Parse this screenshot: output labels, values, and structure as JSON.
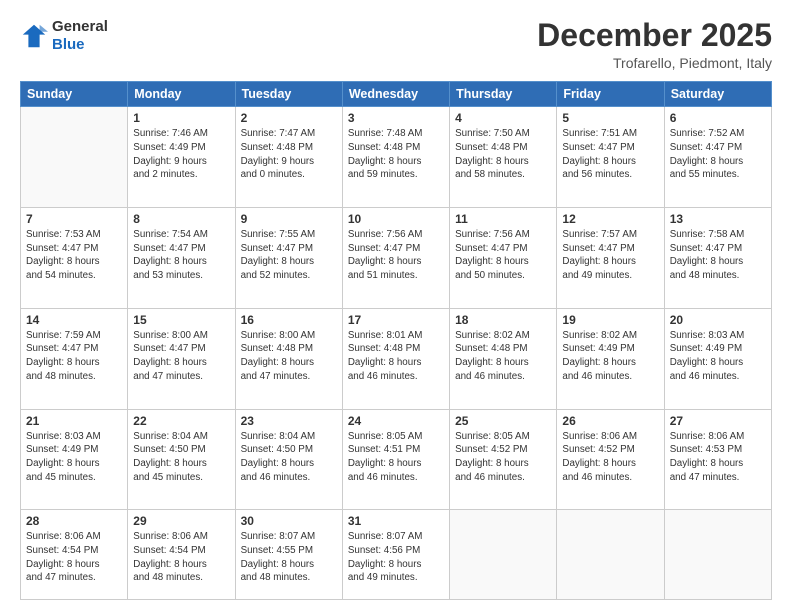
{
  "header": {
    "logo_general": "General",
    "logo_blue": "Blue",
    "month_title": "December 2025",
    "location": "Trofarello, Piedmont, Italy"
  },
  "days_of_week": [
    "Sunday",
    "Monday",
    "Tuesday",
    "Wednesday",
    "Thursday",
    "Friday",
    "Saturday"
  ],
  "weeks": [
    [
      {
        "day": "",
        "info": ""
      },
      {
        "day": "1",
        "info": "Sunrise: 7:46 AM\nSunset: 4:49 PM\nDaylight: 9 hours\nand 2 minutes."
      },
      {
        "day": "2",
        "info": "Sunrise: 7:47 AM\nSunset: 4:48 PM\nDaylight: 9 hours\nand 0 minutes."
      },
      {
        "day": "3",
        "info": "Sunrise: 7:48 AM\nSunset: 4:48 PM\nDaylight: 8 hours\nand 59 minutes."
      },
      {
        "day": "4",
        "info": "Sunrise: 7:50 AM\nSunset: 4:48 PM\nDaylight: 8 hours\nand 58 minutes."
      },
      {
        "day": "5",
        "info": "Sunrise: 7:51 AM\nSunset: 4:47 PM\nDaylight: 8 hours\nand 56 minutes."
      },
      {
        "day": "6",
        "info": "Sunrise: 7:52 AM\nSunset: 4:47 PM\nDaylight: 8 hours\nand 55 minutes."
      }
    ],
    [
      {
        "day": "7",
        "info": "Sunrise: 7:53 AM\nSunset: 4:47 PM\nDaylight: 8 hours\nand 54 minutes."
      },
      {
        "day": "8",
        "info": "Sunrise: 7:54 AM\nSunset: 4:47 PM\nDaylight: 8 hours\nand 53 minutes."
      },
      {
        "day": "9",
        "info": "Sunrise: 7:55 AM\nSunset: 4:47 PM\nDaylight: 8 hours\nand 52 minutes."
      },
      {
        "day": "10",
        "info": "Sunrise: 7:56 AM\nSunset: 4:47 PM\nDaylight: 8 hours\nand 51 minutes."
      },
      {
        "day": "11",
        "info": "Sunrise: 7:56 AM\nSunset: 4:47 PM\nDaylight: 8 hours\nand 50 minutes."
      },
      {
        "day": "12",
        "info": "Sunrise: 7:57 AM\nSunset: 4:47 PM\nDaylight: 8 hours\nand 49 minutes."
      },
      {
        "day": "13",
        "info": "Sunrise: 7:58 AM\nSunset: 4:47 PM\nDaylight: 8 hours\nand 48 minutes."
      }
    ],
    [
      {
        "day": "14",
        "info": "Sunrise: 7:59 AM\nSunset: 4:47 PM\nDaylight: 8 hours\nand 48 minutes."
      },
      {
        "day": "15",
        "info": "Sunrise: 8:00 AM\nSunset: 4:47 PM\nDaylight: 8 hours\nand 47 minutes."
      },
      {
        "day": "16",
        "info": "Sunrise: 8:00 AM\nSunset: 4:48 PM\nDaylight: 8 hours\nand 47 minutes."
      },
      {
        "day": "17",
        "info": "Sunrise: 8:01 AM\nSunset: 4:48 PM\nDaylight: 8 hours\nand 46 minutes."
      },
      {
        "day": "18",
        "info": "Sunrise: 8:02 AM\nSunset: 4:48 PM\nDaylight: 8 hours\nand 46 minutes."
      },
      {
        "day": "19",
        "info": "Sunrise: 8:02 AM\nSunset: 4:49 PM\nDaylight: 8 hours\nand 46 minutes."
      },
      {
        "day": "20",
        "info": "Sunrise: 8:03 AM\nSunset: 4:49 PM\nDaylight: 8 hours\nand 46 minutes."
      }
    ],
    [
      {
        "day": "21",
        "info": "Sunrise: 8:03 AM\nSunset: 4:49 PM\nDaylight: 8 hours\nand 45 minutes."
      },
      {
        "day": "22",
        "info": "Sunrise: 8:04 AM\nSunset: 4:50 PM\nDaylight: 8 hours\nand 45 minutes."
      },
      {
        "day": "23",
        "info": "Sunrise: 8:04 AM\nSunset: 4:50 PM\nDaylight: 8 hours\nand 46 minutes."
      },
      {
        "day": "24",
        "info": "Sunrise: 8:05 AM\nSunset: 4:51 PM\nDaylight: 8 hours\nand 46 minutes."
      },
      {
        "day": "25",
        "info": "Sunrise: 8:05 AM\nSunset: 4:52 PM\nDaylight: 8 hours\nand 46 minutes."
      },
      {
        "day": "26",
        "info": "Sunrise: 8:06 AM\nSunset: 4:52 PM\nDaylight: 8 hours\nand 46 minutes."
      },
      {
        "day": "27",
        "info": "Sunrise: 8:06 AM\nSunset: 4:53 PM\nDaylight: 8 hours\nand 47 minutes."
      }
    ],
    [
      {
        "day": "28",
        "info": "Sunrise: 8:06 AM\nSunset: 4:54 PM\nDaylight: 8 hours\nand 47 minutes."
      },
      {
        "day": "29",
        "info": "Sunrise: 8:06 AM\nSunset: 4:54 PM\nDaylight: 8 hours\nand 48 minutes."
      },
      {
        "day": "30",
        "info": "Sunrise: 8:07 AM\nSunset: 4:55 PM\nDaylight: 8 hours\nand 48 minutes."
      },
      {
        "day": "31",
        "info": "Sunrise: 8:07 AM\nSunset: 4:56 PM\nDaylight: 8 hours\nand 49 minutes."
      },
      {
        "day": "",
        "info": ""
      },
      {
        "day": "",
        "info": ""
      },
      {
        "day": "",
        "info": ""
      }
    ]
  ]
}
